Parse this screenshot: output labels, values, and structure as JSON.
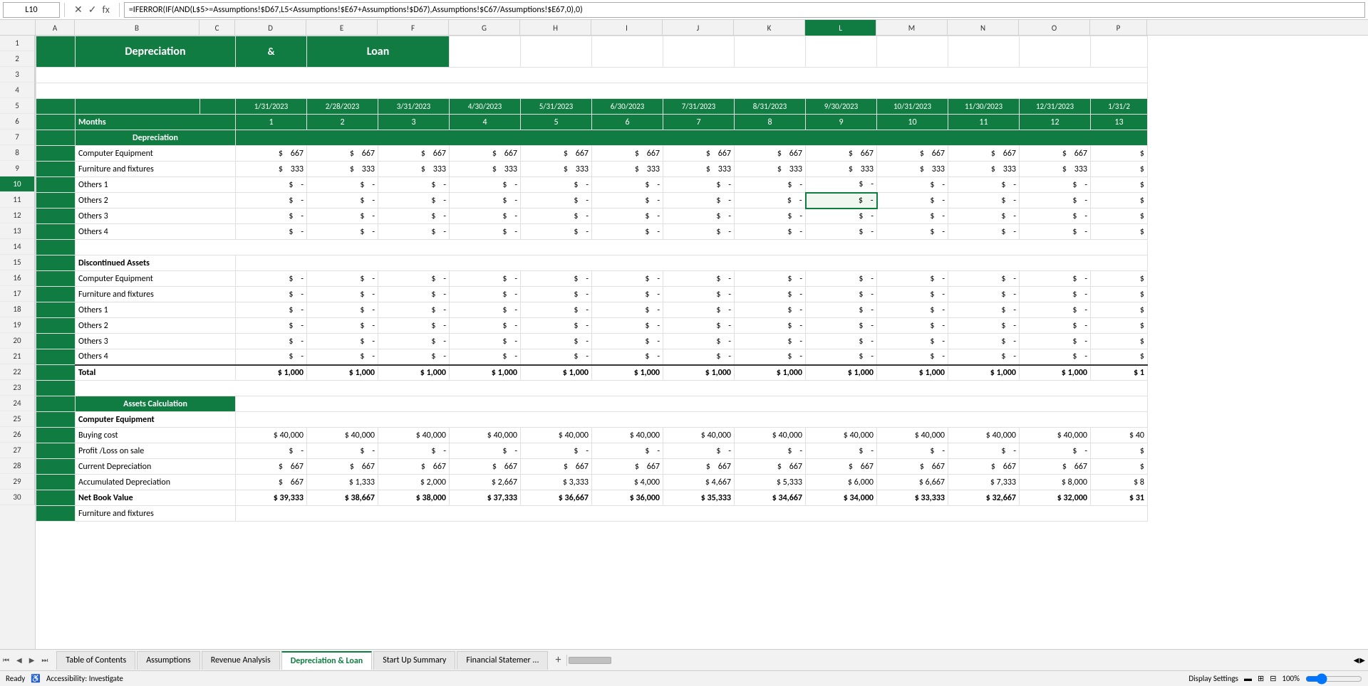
{
  "formula_bar": {
    "cell_ref": "L10",
    "formula": "=IFERROR(IF(AND(L$5>=Assumptions!$D67,L5<Assumptions!$E67+Assumptions!$D67),Assumptions!$C67/Assumptions!$E67,0),0)"
  },
  "columns": {
    "widths": [
      50,
      90,
      130,
      90,
      90,
      90,
      90,
      90,
      90,
      90,
      90,
      90,
      90,
      90,
      90,
      90,
      90,
      80
    ],
    "labels": [
      "",
      "A",
      "B",
      "C",
      "D",
      "E",
      "F",
      "G",
      "H",
      "I",
      "J",
      "K",
      "L",
      "M",
      "N",
      "O",
      "P"
    ],
    "active": "L"
  },
  "header_section": {
    "title1": "Depreciation",
    "title2": "&",
    "title3": "Loan"
  },
  "dates": {
    "row1": [
      "1/31/2023",
      "2/28/2023",
      "3/31/2023",
      "4/30/2023",
      "5/31/2023",
      "6/30/2023",
      "7/31/2023",
      "8/31/2023",
      "9/30/2023",
      "10/31/2023",
      "11/30/2023",
      "12/31/2023",
      "1/31/2"
    ],
    "row2": [
      "1",
      "2",
      "3",
      "4",
      "5",
      "6",
      "7",
      "8",
      "9",
      "10",
      "11",
      "12",
      "13"
    ]
  },
  "rows_label": "Months",
  "depreciation_section": {
    "header": "Depreciation",
    "items": [
      {
        "label": "Computer Equipment",
        "values": [
          667,
          667,
          667,
          667,
          667,
          667,
          667,
          667,
          667,
          667,
          667,
          667,
          ""
        ]
      },
      {
        "label": "Furniture and fixtures",
        "values": [
          333,
          333,
          333,
          333,
          333,
          333,
          333,
          333,
          333,
          333,
          333,
          333,
          ""
        ]
      },
      {
        "label": "Others 1",
        "values": [
          "-",
          "-",
          "-",
          "-",
          "-",
          "-",
          "-",
          "-",
          "-",
          "-",
          "-",
          "-",
          ""
        ]
      },
      {
        "label": "Others 2",
        "values": [
          "-",
          "-",
          "-",
          "-",
          "-",
          "-",
          "-",
          "-",
          "-",
          "-",
          "-",
          "-",
          ""
        ]
      },
      {
        "label": "Others 3",
        "values": [
          "-",
          "-",
          "-",
          "-",
          "-",
          "-",
          "-",
          "-",
          "-",
          "-",
          "-",
          "-",
          ""
        ]
      },
      {
        "label": "Others 4",
        "values": [
          "-",
          "-",
          "-",
          "-",
          "-",
          "-",
          "-",
          "-",
          "-",
          "-",
          "-",
          "-",
          ""
        ]
      }
    ]
  },
  "discontinued_section": {
    "header": "Discontinued Assets",
    "items": [
      {
        "label": "Computer Equipment",
        "values": [
          "-",
          "-",
          "-",
          "-",
          "-",
          "-",
          "-",
          "-",
          "-",
          "-",
          "-",
          "-",
          ""
        ]
      },
      {
        "label": "Furniture and fixtures",
        "values": [
          "-",
          "-",
          "-",
          "-",
          "-",
          "-",
          "-",
          "-",
          "-",
          "-",
          "-",
          "-",
          ""
        ]
      },
      {
        "label": "Others 1",
        "values": [
          "-",
          "-",
          "-",
          "-",
          "-",
          "-",
          "-",
          "-",
          "-",
          "-",
          "-",
          "-",
          ""
        ]
      },
      {
        "label": "Others 2",
        "values": [
          "-",
          "-",
          "-",
          "-",
          "-",
          "-",
          "-",
          "-",
          "-",
          "-",
          "-",
          "-",
          ""
        ]
      },
      {
        "label": "Others 3",
        "values": [
          "-",
          "-",
          "-",
          "-",
          "-",
          "-",
          "-",
          "-",
          "-",
          "-",
          "-",
          "-",
          ""
        ]
      },
      {
        "label": "Others 4",
        "values": [
          "-",
          "-",
          "-",
          "-",
          "-",
          "-",
          "-",
          "-",
          "-",
          "-",
          "-",
          "-",
          ""
        ]
      }
    ],
    "total_label": "Total",
    "total_values": [
      "1,000",
      "1,000",
      "1,000",
      "1,000",
      "1,000",
      "1,000",
      "1,000",
      "1,000",
      "1,000",
      "1,000",
      "1,000",
      "1,000",
      "1"
    ]
  },
  "assets_section": {
    "header": "Assets Calculation",
    "computer_equipment": {
      "label": "Computer Equipment",
      "rows": [
        {
          "label": "Buying cost",
          "values": [
            "40,000",
            "40,000",
            "40,000",
            "40,000",
            "40,000",
            "40,000",
            "40,000",
            "40,000",
            "40,000",
            "40,000",
            "40,000",
            "40,000",
            "40"
          ]
        },
        {
          "label": "Profit /Loss on sale",
          "values": [
            "-",
            "-",
            "-",
            "-",
            "-",
            "-",
            "-",
            "-",
            "-",
            "-",
            "-",
            "-",
            ""
          ]
        },
        {
          "label": "Current Depreciation",
          "values": [
            "667",
            "667",
            "667",
            "667",
            "667",
            "667",
            "667",
            "667",
            "667",
            "667",
            "667",
            "667",
            ""
          ]
        },
        {
          "label": "Accumulated Depreciation",
          "values": [
            "667",
            "1,333",
            "2,000",
            "2,667",
            "3,333",
            "4,000",
            "4,667",
            "5,333",
            "6,000",
            "6,667",
            "7,333",
            "8,000",
            "8"
          ]
        },
        {
          "label": "Net Book Value",
          "values": [
            "39,333",
            "38,667",
            "38,000",
            "37,333",
            "36,667",
            "36,000",
            "35,333",
            "34,667",
            "34,000",
            "33,333",
            "32,667",
            "32,000",
            "31"
          ]
        }
      ]
    },
    "furniture_label": "Furniture and fixtures"
  },
  "tabs": [
    {
      "label": "Table of Contents",
      "active": false
    },
    {
      "label": "Assumptions",
      "active": false
    },
    {
      "label": "Revenue Analysis",
      "active": false
    },
    {
      "label": "Depreciation & Loan",
      "active": true
    },
    {
      "label": "Start Up Summary",
      "active": false
    },
    {
      "label": "Financial Statemer ...",
      "active": false
    }
  ],
  "status": {
    "left": "Ready",
    "accessibility": "Accessibility: Investigate",
    "right_items": [
      "Display Settings",
      "100%"
    ],
    "zoom": "100%"
  },
  "colors": {
    "teal": "#107c41",
    "light_teal": "#1e8449",
    "header_bg": "#107c41",
    "selected_border": "#107c41"
  }
}
